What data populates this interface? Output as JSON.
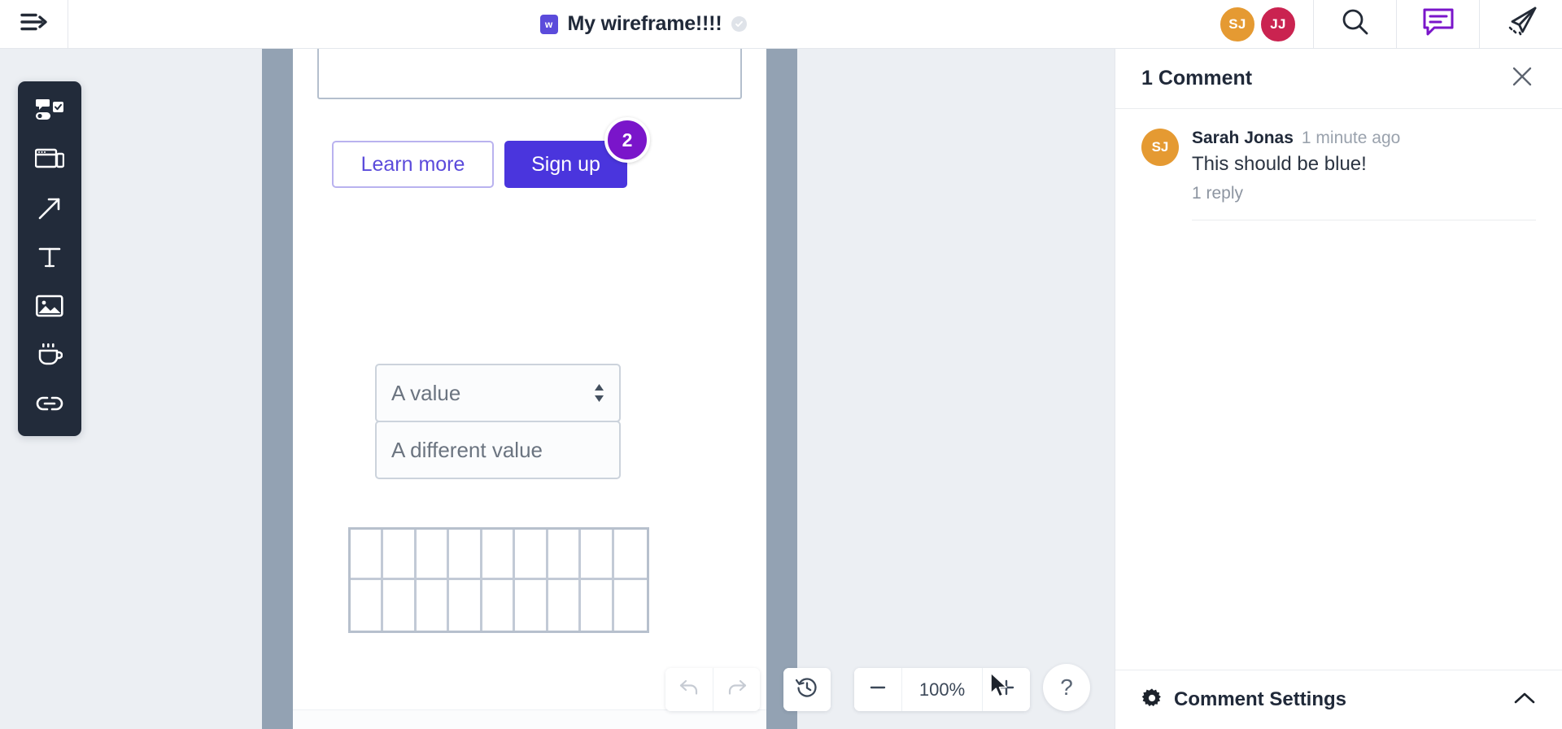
{
  "topbar": {
    "menu_icon": "menu-arrow-icon",
    "doc_logo_letter": "w",
    "doc_title": "My wireframe!!!!",
    "saved_badge_icon": "check-circle-icon",
    "avatars": [
      {
        "initials": "SJ",
        "color": "#e59a32"
      },
      {
        "initials": "JJ",
        "color": "#ca2350"
      }
    ],
    "actions": [
      {
        "name": "search-icon"
      },
      {
        "name": "comment-icon",
        "color": "#7a15ca"
      },
      {
        "name": "send-icon"
      }
    ]
  },
  "toolbar": {
    "tools": [
      {
        "name": "components-icon",
        "label": "Components"
      },
      {
        "name": "containers-icon",
        "label": "Containers"
      },
      {
        "name": "arrow-icon",
        "label": "Arrow"
      },
      {
        "name": "text-icon",
        "label": "Text"
      },
      {
        "name": "image-icon",
        "label": "Image"
      },
      {
        "name": "icons-icon",
        "label": "Icons"
      },
      {
        "name": "link-icon",
        "label": "Link"
      }
    ]
  },
  "artboard": {
    "textarea_value": "",
    "buttons": {
      "secondary_label": "Learn more",
      "primary_label": "Sign up"
    },
    "comment_pin": {
      "count": "2",
      "color": "#7a15ca"
    },
    "select": {
      "value": "A value"
    },
    "input": {
      "value": "A different value"
    },
    "table": {
      "columns": 9,
      "rows": 2
    }
  },
  "bottombar": {
    "undo_label": "undo-icon",
    "redo_label": "redo-icon",
    "history_label": "history-icon",
    "zoom_out_label": "minus-icon",
    "zoom_level": "100%",
    "zoom_in_label": "plus-icon",
    "help_label": "?"
  },
  "comments": {
    "header_title": "1 Comment",
    "close_icon": "close-icon",
    "thread": {
      "avatar_initials": "SJ",
      "author": "Sarah Jonas",
      "time": "1 minute ago",
      "text": "This should be blue!",
      "replies": "1 reply"
    },
    "footer": {
      "icon": "gear-icon",
      "label": "Comment Settings",
      "chevron": "chevron-up-icon"
    }
  }
}
